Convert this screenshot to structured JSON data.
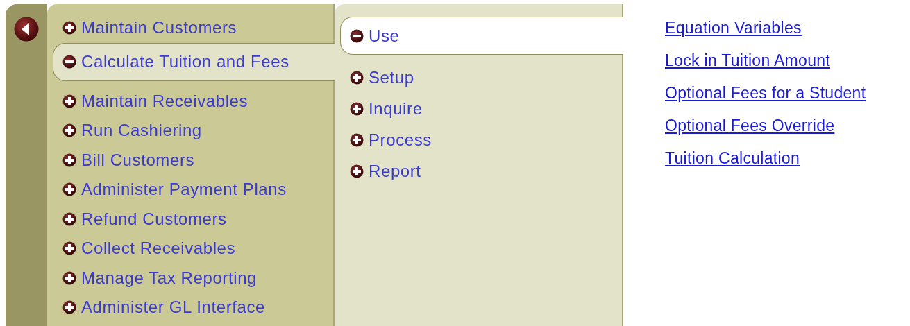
{
  "categories": [
    {
      "label": "Maintain Customers",
      "expanded": false,
      "selected": false
    },
    {
      "label": "Calculate Tuition and Fees",
      "expanded": true,
      "selected": true
    },
    {
      "label": "Maintain Receivables",
      "expanded": false,
      "selected": false
    },
    {
      "label": "Run Cashiering",
      "expanded": false,
      "selected": false
    },
    {
      "label": "Bill Customers",
      "expanded": false,
      "selected": false
    },
    {
      "label": "Administer Payment Plans",
      "expanded": false,
      "selected": false
    },
    {
      "label": "Refund Customers",
      "expanded": false,
      "selected": false
    },
    {
      "label": "Collect Receivables",
      "expanded": false,
      "selected": false
    },
    {
      "label": "Manage Tax Reporting",
      "expanded": false,
      "selected": false
    },
    {
      "label": "Administer GL Interface",
      "expanded": false,
      "selected": false
    }
  ],
  "subcategories": [
    {
      "label": "Use",
      "expanded": true,
      "selected": true
    },
    {
      "label": "Setup",
      "expanded": false,
      "selected": false
    },
    {
      "label": "Inquire",
      "expanded": false,
      "selected": false
    },
    {
      "label": "Process",
      "expanded": false,
      "selected": false
    },
    {
      "label": "Report",
      "expanded": false,
      "selected": false
    }
  ],
  "links": [
    "Equation Variables",
    "Lock in Tuition Amount",
    "Optional Fees for a Student",
    "Optional Fees Override",
    "Tuition Calculation"
  ]
}
